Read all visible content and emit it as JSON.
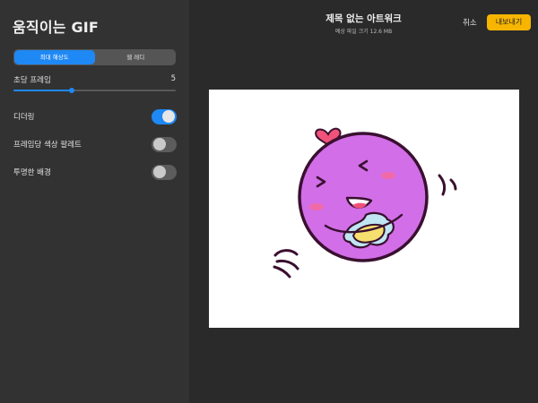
{
  "sidebar": {
    "title": "움직이는 GIF",
    "segments": [
      {
        "label": "최대 해상도",
        "active": true
      },
      {
        "label": "웹 레디",
        "active": false
      }
    ],
    "fps": {
      "label": "초당 프레임",
      "value": "5",
      "level": 0.36
    },
    "toggles": [
      {
        "label": "디더링",
        "on": true
      },
      {
        "label": "프레임당 색상 팔레트",
        "on": false
      },
      {
        "label": "투명한 배경",
        "on": false
      }
    ]
  },
  "header": {
    "title": "제목 없는 아트워크",
    "subtitle": "예상 파일 크기 12.6 MB",
    "cancel_label": "취소",
    "export_label": "내보내기"
  },
  "colors": {
    "accent": "#1e88f5",
    "export": "#f7b500",
    "character_fill": "#d26ee8",
    "outline": "#3a1030"
  },
  "canvas": {
    "character": "purple-smiley-character"
  }
}
